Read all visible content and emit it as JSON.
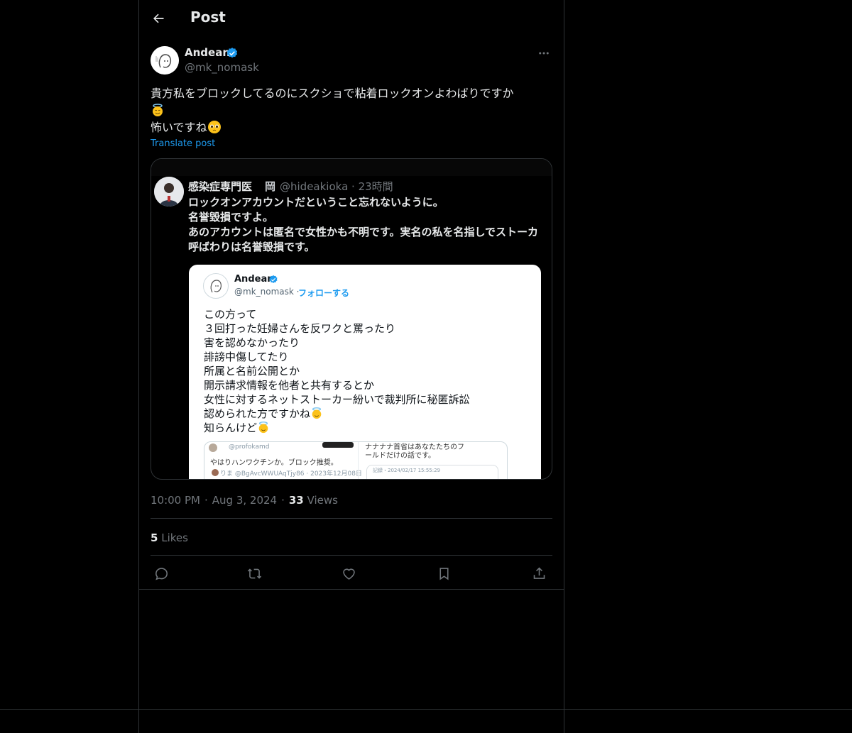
{
  "header": {
    "title": "Post"
  },
  "author": {
    "name": "Andean",
    "handle": "@mk_nomask"
  },
  "post": {
    "line1": "貴方私をブロックしてるのにスクショで粘着ロックオンよわばりですか",
    "line3": "怖いですね",
    "translate_label": "Translate post"
  },
  "embed": {
    "name": "感染症専門医",
    "icon_char": "岡",
    "handle_time": "@hideakioka · 23時間",
    "lines": [
      "ロックオンアカウントだということ忘れないように。",
      "名誉毀損ですよ。",
      "あのアカウントは匿名で女性かも不明です。実名の私を名指しでストーカ",
      "呼ばわりは名誉毀損です。"
    ],
    "inner": {
      "name": "Andean",
      "handle": "@mk_nomask ·",
      "follow": "フォローする",
      "lines": [
        "この方って",
        "３回打った妊婦さんを反ワクと罵ったり",
        "害を認めなかったり",
        "誹謗中傷してたり",
        "所属と名前公開とか",
        "開示請求情報を他者と共有するとか",
        "女性に対するネットストーカー紛いで裁判所に秘匿訴訟",
        "認められた方ですかね",
        "知らんけど"
      ],
      "sub": {
        "handle1": "@profokamd",
        "text1": "やはりハンワクチンか。ブロック推奨。",
        "handle2": "りま @BgAvcWWUAqTjy86 · 2023年12月08日",
        "right1": "ナナナナ首省はあなたたちのフ",
        "right2": "ールドだけの話です。",
        "mini": "記録・2024/02/17 15:55:29"
      }
    }
  },
  "meta": {
    "time": "10:00 PM",
    "date": "Aug 3, 2024",
    "views_count": "33",
    "views_label": "Views"
  },
  "likes": {
    "count": "5",
    "label": "Likes"
  },
  "actions": [
    "reply-icon",
    "repost-icon",
    "like-icon",
    "bookmark-icon",
    "share-icon"
  ],
  "colors": {
    "accent": "#1d9bf0",
    "background": "#000000",
    "text": "#e7e9ea",
    "muted": "#71767b",
    "border": "#2f3336"
  }
}
